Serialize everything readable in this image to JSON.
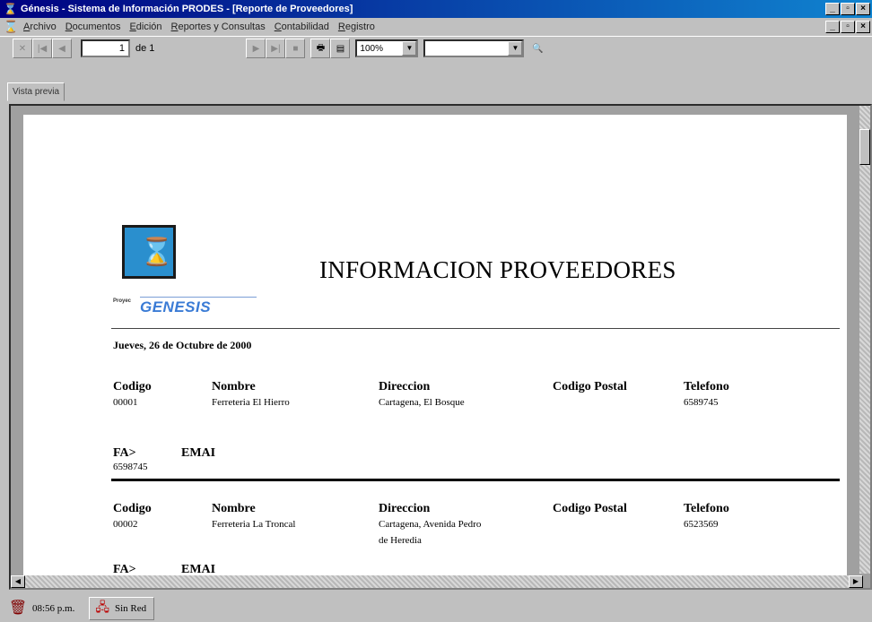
{
  "window": {
    "title": "Génesis - Sistema de Información PRODES - [Reporte de Proveedores]",
    "buttons": [
      "_",
      "▫",
      "×"
    ]
  },
  "menu": {
    "items": [
      "Archivo",
      "Documentos",
      "Edición",
      "Reportes y Consultas",
      "Contabilidad",
      "Registro"
    ]
  },
  "toolbar": {
    "page_current": "1",
    "page_of": "de 1",
    "zoom": "100%",
    "search_value": ""
  },
  "tab": {
    "label": "Vista previa"
  },
  "report": {
    "title": "INFORMACION PROVEEDORES",
    "date": "Jueves, 26 de Octubre de 2000",
    "logo_project": "Proyec",
    "logo_name": "GENESIS",
    "headers": {
      "codigo": "Codigo",
      "nombre": "Nombre",
      "direccion": "Direccion",
      "codigo_postal": "Codigo Postal",
      "telefono": "Telefono",
      "fax": "FA>",
      "email": "EMAI"
    },
    "records": [
      {
        "codigo": "00001",
        "nombre": "Ferreteria El Hierro",
        "direccion": "Cartagena, El Bosque",
        "codigo_postal": "",
        "telefono": "6589745",
        "fax": "6598745",
        "email": ""
      },
      {
        "codigo": "00002",
        "nombre": "Ferreteria La Troncal",
        "direccion_line1": "Cartagena, Avenida Pedro",
        "direccion_line2": "de Heredia",
        "codigo_postal": "",
        "telefono": "6523569"
      }
    ]
  },
  "status": {
    "time": "08:56 p.m.",
    "network": "Sin Red"
  }
}
